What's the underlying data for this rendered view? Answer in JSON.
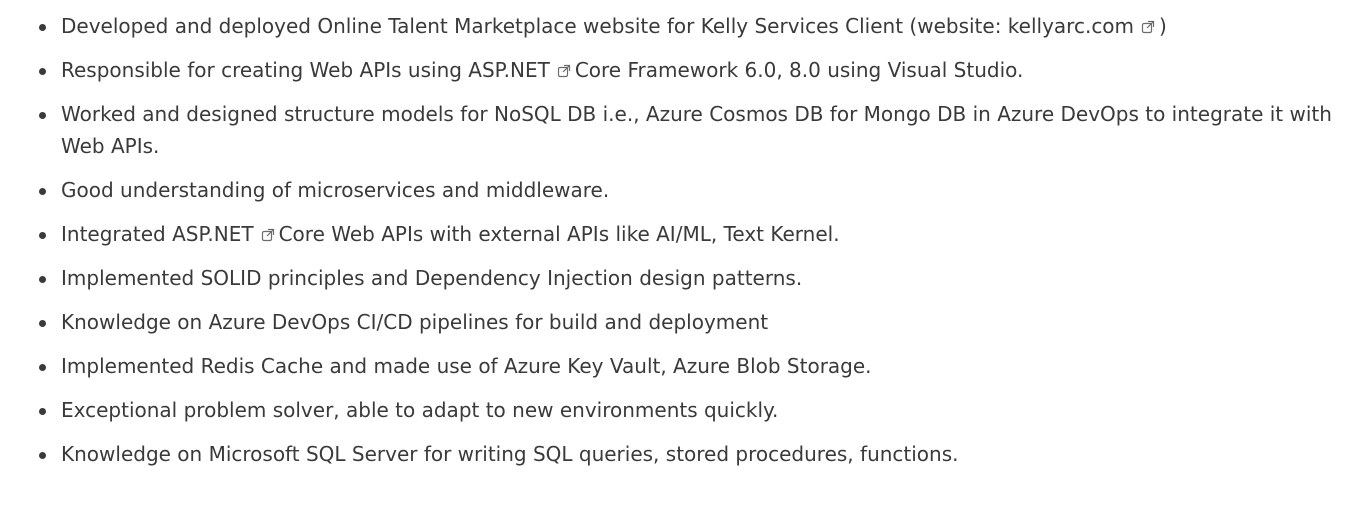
{
  "items": [
    {
      "before": "Developed and deployed Online Talent Marketplace website for Kelly Services Client (website: kellyarc.com",
      "icon": "external-link-icon",
      "after": ")"
    },
    {
      "before": "Responsible for creating Web APIs using ASP.NET",
      "icon": "external-link-icon",
      "after": "Core Framework 6.0, 8.0 using Visual Studio."
    },
    {
      "before": "Worked and designed structure models for NoSQL DB i.e., Azure Cosmos DB for Mongo DB in Azure DevOps to integrate it with Web APIs."
    },
    {
      "before": "Good understanding of microservices and middleware."
    },
    {
      "before": "Integrated ASP.NET",
      "icon": "external-link-icon",
      "after": "Core Web APIs with external APIs like AI/ML, Text Kernel."
    },
    {
      "before": "Implemented SOLID principles and Dependency Injection design patterns."
    },
    {
      "before": "Knowledge on Azure DevOps CI/CD pipelines for build and deployment"
    },
    {
      "before": "Implemented Redis Cache and made use of Azure Key Vault, Azure Blob Storage."
    },
    {
      "before": "Exceptional problem solver, able to adapt to new environments quickly."
    },
    {
      "before": "Knowledge on Microsoft SQL Server for writing SQL queries, stored procedures, functions."
    }
  ],
  "colors": {
    "text": "#3a3a3a",
    "icon": "#6b6b6b",
    "background": "#ffffff"
  }
}
